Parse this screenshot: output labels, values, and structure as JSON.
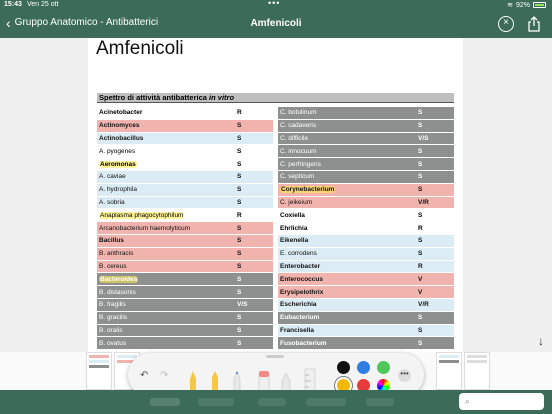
{
  "status": {
    "time": "15:43",
    "date": "Ven 25 ott",
    "battery": "92%"
  },
  "nav": {
    "back_label": "Gruppo Anatomico - Antibatterici",
    "title": "Amfenicoli"
  },
  "page": {
    "title": "Amfenicoli",
    "section_title": "Spettro di attività antibatterica",
    "section_title_italic": "in vitro",
    "left_rows": [
      {
        "name": "Acinetobacter",
        "val": "R",
        "style": "bw",
        "bold": true
      },
      {
        "name": "Actinomyces",
        "val": "S",
        "style": "br",
        "bold": true
      },
      {
        "name": "Actinobacillus",
        "val": "S",
        "style": "bb",
        "bold": true
      },
      {
        "name": "A. pyogenes",
        "val": "S",
        "style": "bw",
        "bold": false
      },
      {
        "name": "Aeromonas",
        "val": "S",
        "style": "bw",
        "bold": true,
        "hl": true
      },
      {
        "name": "A. caviae",
        "val": "S",
        "style": "bb",
        "bold": false
      },
      {
        "name": "A. hydrophila",
        "val": "S",
        "style": "bb",
        "bold": false
      },
      {
        "name": "A. sobria",
        "val": "S",
        "style": "bb",
        "bold": false
      },
      {
        "name": "Anaplasma phagocytophilum",
        "val": "R",
        "style": "bw",
        "bold": false,
        "hl": true
      },
      {
        "name": "Arcanobacterium haemolyticum",
        "val": "S",
        "style": "br",
        "bold": false
      },
      {
        "name": "Bacillus",
        "val": "S",
        "style": "br",
        "bold": true
      },
      {
        "name": "B. anthracis",
        "val": "S",
        "style": "br",
        "bold": false
      },
      {
        "name": "B. cereus",
        "val": "S",
        "style": "br",
        "bold": false
      },
      {
        "name": "Bacteroides",
        "val": "S",
        "style": "bg",
        "bold": true,
        "hl": true
      },
      {
        "name": "B. distasonis",
        "val": "S",
        "style": "bg",
        "bold": false
      },
      {
        "name": "B. fragilis",
        "val": "V/S",
        "style": "bg",
        "bold": false
      },
      {
        "name": "B. gracilis",
        "val": "S",
        "style": "bg",
        "bold": false
      },
      {
        "name": "B. oralis",
        "val": "S",
        "style": "bg",
        "bold": false
      },
      {
        "name": "B. ovatus",
        "val": "S",
        "style": "bg",
        "bold": false
      }
    ],
    "right_rows": [
      {
        "name": "C. botulinum",
        "val": "S",
        "style": "bg",
        "bold": false
      },
      {
        "name": "C. cadaveris",
        "val": "S",
        "style": "bg",
        "bold": false
      },
      {
        "name": "C. difficile",
        "val": "V/S",
        "style": "bg",
        "bold": false
      },
      {
        "name": "C. innocuum",
        "val": "S",
        "style": "bg",
        "bold": false
      },
      {
        "name": "C. perfringens",
        "val": "S",
        "style": "bg",
        "bold": false
      },
      {
        "name": "C. septicum",
        "val": "S",
        "style": "bg",
        "bold": false
      },
      {
        "name": "Corynebacterium",
        "val": "S",
        "style": "br",
        "bold": true,
        "hl": true
      },
      {
        "name": "C. jeikeium",
        "val": "V/R",
        "style": "br",
        "bold": false
      },
      {
        "name": "Coxiella",
        "val": "S",
        "style": "bw",
        "bold": true
      },
      {
        "name": "Ehrlichia",
        "val": "R",
        "style": "bw",
        "bold": true
      },
      {
        "name": "Eikenella",
        "val": "S",
        "style": "bb",
        "bold": true
      },
      {
        "name": "E. corrodens",
        "val": "S",
        "style": "bb",
        "bold": false
      },
      {
        "name": "Enterobacter",
        "val": "R",
        "style": "bb",
        "bold": true
      },
      {
        "name": "Enterococcus",
        "val": "V",
        "style": "br",
        "bold": true
      },
      {
        "name": "Erysipelothrix",
        "val": "V",
        "style": "br",
        "bold": true
      },
      {
        "name": "Escherichia",
        "val": "V/R",
        "style": "bb",
        "bold": true
      },
      {
        "name": "Eubacterium",
        "val": "S",
        "style": "bg",
        "bold": true
      },
      {
        "name": "Francisella",
        "val": "S",
        "style": "bb",
        "bold": true
      },
      {
        "name": "Fusobacterium",
        "val": "S",
        "style": "bg",
        "bold": true
      }
    ]
  },
  "toolbar": {
    "undo_icon": "undo-icon",
    "redo_icon": "redo-icon",
    "colors": [
      "#111111",
      "#2f7de1",
      "#4fc85a",
      "#f5b800",
      "#e83b3b"
    ]
  }
}
